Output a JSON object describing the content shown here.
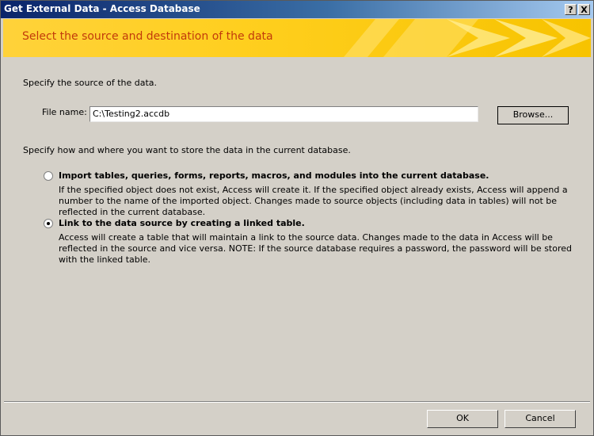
{
  "window": {
    "title": "Get External Data - Access Database",
    "help_button": "?",
    "close_button": "X"
  },
  "banner": {
    "heading": "Select the source and destination of the data"
  },
  "source": {
    "prompt": "Specify the source of the data.",
    "file_label": "File name:",
    "file_value": "C:\\Testing2.accdb",
    "browse_label": "Browse..."
  },
  "storage": {
    "prompt": "Specify how and where you want to store the data in the current database.",
    "options": [
      {
        "title": "Import tables, queries, forms, reports, macros, and modules into the current database.",
        "description": "If the specified object does not exist, Access will create it. If the specified object already exists, Access will append a number to the name of the imported object. Changes made to source objects (including data in tables) will not be reflected in the current database.",
        "selected": false
      },
      {
        "title": "Link to the data source by creating a linked table.",
        "description": "Access will create a table that will maintain a link to the source data. Changes made to the data in Access will be reflected in the source and vice versa. NOTE:  If the source database requires a password, the password will be stored with the linked table.",
        "selected": true
      }
    ]
  },
  "footer": {
    "ok_label": "OK",
    "cancel_label": "Cancel"
  }
}
